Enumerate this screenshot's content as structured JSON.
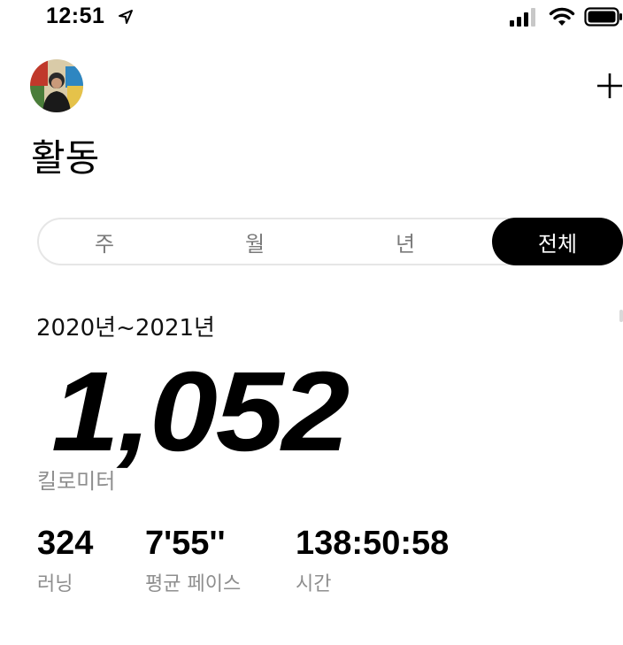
{
  "status_bar": {
    "time": "12:51"
  },
  "header": {
    "title": "활동"
  },
  "segmented_control": {
    "items": [
      {
        "label": "주",
        "active": false
      },
      {
        "label": "월",
        "active": false
      },
      {
        "label": "년",
        "active": false
      },
      {
        "label": "전체",
        "active": true
      }
    ]
  },
  "summary": {
    "range": "2020년~2021년",
    "distance_value": "1,052",
    "distance_unit": "킬로미터",
    "stats": [
      {
        "value": "324",
        "label": "러닝"
      },
      {
        "value": "7'55''",
        "label": "평균 페이스"
      },
      {
        "value": "138:50:58",
        "label": "시간"
      }
    ]
  },
  "colors": {
    "accent": "#000000",
    "secondary_text": "#8e8e8e",
    "segment_border": "#e6e6e6"
  }
}
